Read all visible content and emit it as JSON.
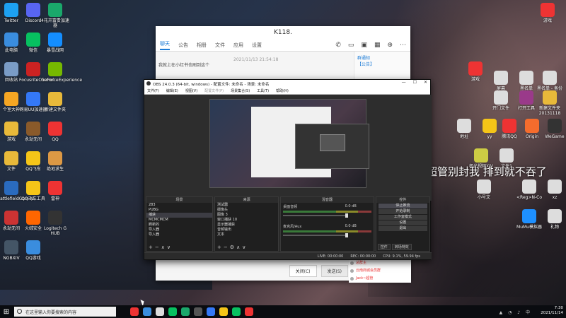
{
  "desktop": {
    "left_icons": [
      {
        "label": "Twitter",
        "icon": "twitter-icon",
        "color": "#1da1f2"
      },
      {
        "label": "Discord",
        "icon": "discord-icon",
        "color": "#5865f2"
      },
      {
        "label": "4花开富贵加速器",
        "icon": "accelerator-icon",
        "color": "#1aa86b"
      },
      {
        "label": "此电脑",
        "icon": "computer-icon",
        "color": "#3a8dde"
      },
      {
        "label": "微信",
        "icon": "wechat-icon",
        "color": "#07c160"
      },
      {
        "label": "暴雪战网",
        "icon": "battlenet-icon",
        "color": "#148eff"
      },
      {
        "label": "回收站",
        "icon": "recycle-bin-icon",
        "color": "#7a9cc6"
      },
      {
        "label": "FocusriteControl",
        "icon": "focusrite-icon",
        "color": "#c22"
      },
      {
        "label": "GeForceExperience",
        "icon": "geforce-icon",
        "color": "#76b900"
      },
      {
        "label": "个室大神",
        "icon": "dashen-icon",
        "color": "#f5a623"
      },
      {
        "label": "网易UU加速器",
        "icon": "uu-icon",
        "color": "#3478f6"
      },
      {
        "label": "新建文件夹",
        "icon": "folder-icon",
        "color": "#e8b93a"
      },
      {
        "label": "游戏",
        "icon": "game-folder-icon",
        "color": "#e8b93a"
      },
      {
        "label": "永劫无间",
        "icon": "naraka-icon",
        "color": "#8a5a2a"
      },
      {
        "label": "QQ",
        "icon": "qq-icon",
        "color": "#e33"
      },
      {
        "label": "文件",
        "icon": "file-icon",
        "color": "#e8b93a"
      },
      {
        "label": "QQ飞车",
        "icon": "qqspeed-icon",
        "color": "#f5c518"
      },
      {
        "label": "绝地求生",
        "icon": "pubg-icon",
        "color": "#d94"
      },
      {
        "label": "BattlefieldGames",
        "icon": "battlefield-icon",
        "color": "#2a6bbf"
      },
      {
        "label": "QQ飞车工具",
        "icon": "qqtool-icon",
        "color": "#f5c518"
      },
      {
        "label": "雷神",
        "icon": "leishen-icon",
        "color": "#e33"
      },
      {
        "label": "永劫无间",
        "icon": "naraka2-icon",
        "color": "#c33"
      },
      {
        "label": "火绒安全",
        "icon": "huorong-icon",
        "color": "#f60"
      },
      {
        "label": "Logitech G HUB",
        "icon": "logitech-icon",
        "color": "#333"
      },
      {
        "label": "NGBXIV",
        "icon": "ngb-icon",
        "color": "#456"
      },
      {
        "label": "QQ游戏",
        "icon": "qqgame-icon",
        "color": "#3a8dde"
      }
    ],
    "right_icons": [
      {
        "label": "游戏",
        "icon": "game-icon",
        "color": "#e33"
      },
      {
        "label": "屏幕",
        "icon": "screen-icon",
        "color": "#ddd"
      },
      {
        "label": "黑名单",
        "icon": "doc-icon",
        "color": "#ddd"
      },
      {
        "label": "黑名单 - 备份",
        "icon": "doc-icon",
        "color": "#ddd"
      },
      {
        "label": "开门文件",
        "icon": "doc-icon",
        "color": "#ddd"
      },
      {
        "label": "打开工具",
        "icon": "winrar-icon",
        "color": "#9a3a8a"
      },
      {
        "label": "新建文件夹20131118",
        "icon": "folder-icon",
        "color": "#e8b93a"
      },
      {
        "label": "地址",
        "icon": "doc-icon",
        "color": "#ddd"
      },
      {
        "label": "yy",
        "icon": "yy-icon",
        "color": "#f5c518"
      },
      {
        "label": "腾讯QQ",
        "icon": "qq-icon",
        "color": "#e33"
      },
      {
        "label": "Origin",
        "icon": "origin-icon",
        "color": "#f56c2d"
      },
      {
        "label": "WeGame",
        "icon": "wegame-icon",
        "color": "#333"
      },
      {
        "label": "极光视频XIV",
        "icon": "xiv-icon",
        "color": "#cc4"
      },
      {
        "label": "文件1",
        "icon": "doc-icon",
        "color": "#ddd"
      },
      {
        "label": "<Reg>N-Co",
        "icon": "doc-icon",
        "color": "#ddd"
      },
      {
        "label": "xz",
        "icon": "doc-icon",
        "color": "#ddd"
      },
      {
        "label": "MuMu模拟器",
        "icon": "mumu-icon",
        "color": "#1e90ff"
      },
      {
        "label": "礼物",
        "icon": "doc-icon",
        "color": "#ddd"
      },
      {
        "label": "小号文",
        "icon": "doc-icon",
        "color": "#ddd"
      }
    ],
    "top_right_icon": {
      "label": "游戏",
      "icon": "game-top-icon",
      "color": "#e33"
    },
    "overlay_text": "超管别封我 排到就不吞了"
  },
  "chat": {
    "title": "K118.",
    "tabs": [
      "聊天",
      "公告",
      "相册",
      "文件",
      "应用",
      "设置"
    ],
    "time": "2021/11/13 21:54:18",
    "message": "我就上在小红书也刷到这个",
    "side_title": "群通知",
    "side_subtitle": "【公告】",
    "close_button": "关闭(C)",
    "send_button": "发送(S)"
  },
  "side_list": [
    "总群主",
    "云南商城会员群",
    "Jack~超管"
  ],
  "obs": {
    "title": "OBS 24.0.3 (64-bit, windows) - 配置文件: 未命名 - 场景: 未命名",
    "menu": [
      "文件(F)",
      "编辑(E)",
      "视图(V)",
      "配置文件(P)",
      "场景集合(S)",
      "工具(T)",
      "帮助(H)"
    ],
    "scenes_title": "场景",
    "scenes": [
      "283",
      "PUBG",
      "捕获",
      "MCMCMCM",
      "刷新的",
      "导入器",
      "导入器"
    ],
    "sources_title": "来源",
    "sources": [
      "测试器",
      "摄像头",
      "图像 3",
      "窗口捕获 10",
      "显示器捕获",
      "音频输出",
      "文本"
    ],
    "mixer_title": "混音器",
    "mixer": [
      {
        "name": "桌面音频",
        "db": "0.0 dB"
      },
      {
        "name": "麦克风/Aux",
        "db": "0.0 dB"
      }
    ],
    "controls_title": "控件",
    "controls": [
      "停止推流",
      "开始录制",
      "工作室模式",
      "设置",
      "退出"
    ],
    "dock_tabs": [
      "控件",
      "转场特效"
    ],
    "status": [
      "LIVE: 00:00:00",
      "REC: 00:00:00",
      "CPU: 9.1%, 59.94 fps"
    ]
  },
  "taskbar": {
    "search_placeholder": "在这里输入你要搜索的内容",
    "time": "7:30",
    "date": "2021/11/14",
    "apps": [
      "#e33",
      "#3a8dde",
      "#ddd",
      "#07c160",
      "#1aa86b",
      "#555",
      "#3478f6",
      "#f5c518",
      "#07c160",
      "#e33"
    ]
  }
}
